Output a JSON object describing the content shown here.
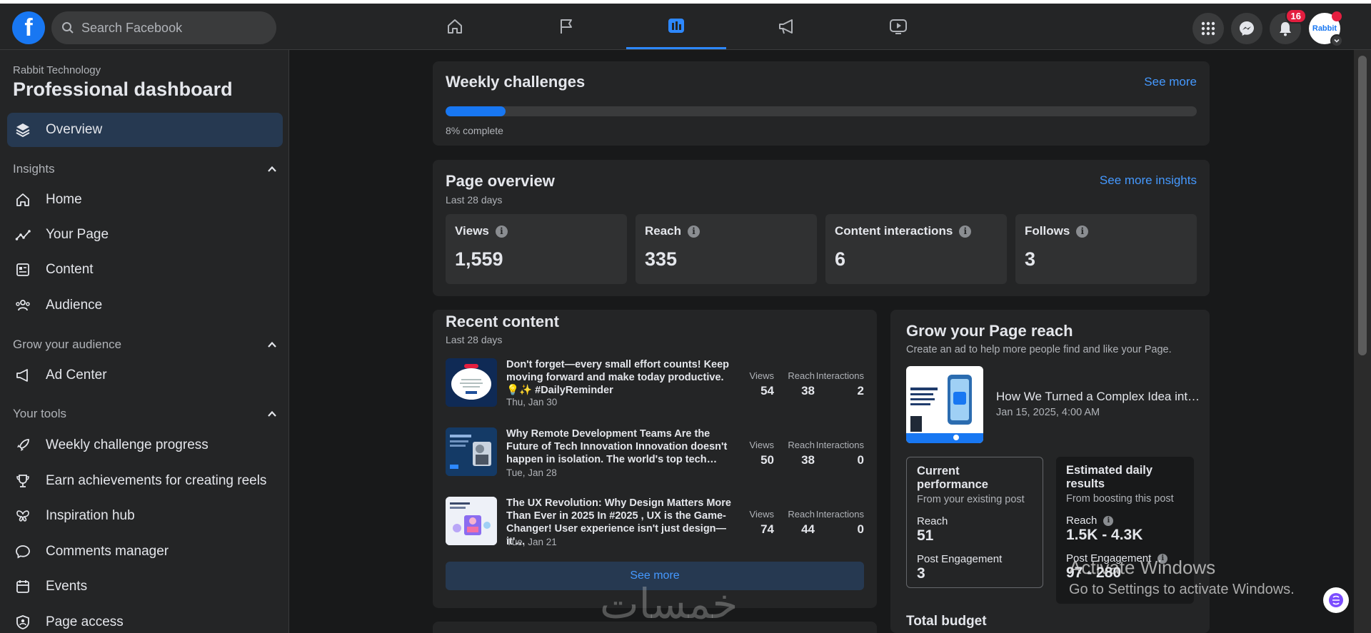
{
  "nav": {
    "logo": "f",
    "search_placeholder": "Search Facebook",
    "notifications_count": "16",
    "avatar_text": "Rabbit"
  },
  "sidebar": {
    "subtitle": "Rabbit Technology",
    "title": "Professional dashboard",
    "overview": "Overview",
    "insights_header": "Insights",
    "insights_items": [
      "Home",
      "Your Page",
      "Content",
      "Audience"
    ],
    "grow_header": "Grow your audience",
    "grow_items": [
      "Ad Center"
    ],
    "tools_header": "Your tools",
    "tools_items": [
      "Weekly challenge progress",
      "Earn achievements for creating reels",
      "Inspiration hub",
      "Comments manager",
      "Events",
      "Page access"
    ]
  },
  "weekly": {
    "title": "Weekly challenges",
    "see_more": "See more",
    "progress_percent": 8,
    "progress_label": "8% complete"
  },
  "overview": {
    "title": "Page overview",
    "period": "Last 28 days",
    "see_more": "See more insights",
    "metrics": [
      {
        "label": "Views",
        "value": "1,559"
      },
      {
        "label": "Reach",
        "value": "335"
      },
      {
        "label": "Content interactions",
        "value": "6"
      },
      {
        "label": "Follows",
        "value": "3"
      }
    ]
  },
  "recent": {
    "title": "Recent content",
    "period": "Last 28 days",
    "headers": {
      "views": "Views",
      "reach": "Reach",
      "interactions": "Interactions"
    },
    "posts": [
      {
        "text": "Don't forget—every small effort counts! Keep moving forward and make today productive. 💡✨ #DailyReminder",
        "date": "Thu, Jan 30",
        "views": "54",
        "reach": "38",
        "interactions": "2"
      },
      {
        "text": "Why Remote Development Teams Are the Future of Tech Innovation Innovation doesn't happen in isolation. The world's top tech…",
        "date": "Tue, Jan 28",
        "views": "50",
        "reach": "38",
        "interactions": "0"
      },
      {
        "text": "The UX Revolution: Why Design Matters More Than Ever in 2025 In #2025 , UX is the Game-Changer! User experience isn't just design—it'…",
        "date": "Tue, Jan 21",
        "views": "74",
        "reach": "44",
        "interactions": "0"
      }
    ],
    "see_more": "See more"
  },
  "grow": {
    "title": "Grow your Page reach",
    "subtitle": "Create an ad to help more people find and like your Page.",
    "post_title": "How We Turned a Complex Idea int…",
    "post_date": "Jan 15, 2025, 4:00 AM",
    "current": {
      "title": "Current performance",
      "subtitle": "From your existing post",
      "reach_label": "Reach",
      "reach_value": "51",
      "eng_label": "Post Engagement",
      "eng_value": "3"
    },
    "estimated": {
      "title": "Estimated daily results",
      "subtitle": "From boosting this post",
      "reach_label": "Reach",
      "reach_value": "1.5K - 4.3K",
      "eng_label": "Post Engagement",
      "eng_value": "97 - 280"
    },
    "budget_title": "Total budget"
  },
  "overlay": {
    "activate_title": "Activate Windows",
    "activate_sub": "Go to Settings to activate Windows.",
    "watermark": "خمسات"
  },
  "colors": {
    "accent": "#1877f2",
    "link": "#4599ff",
    "card": "#242526",
    "background": "#18191a"
  }
}
